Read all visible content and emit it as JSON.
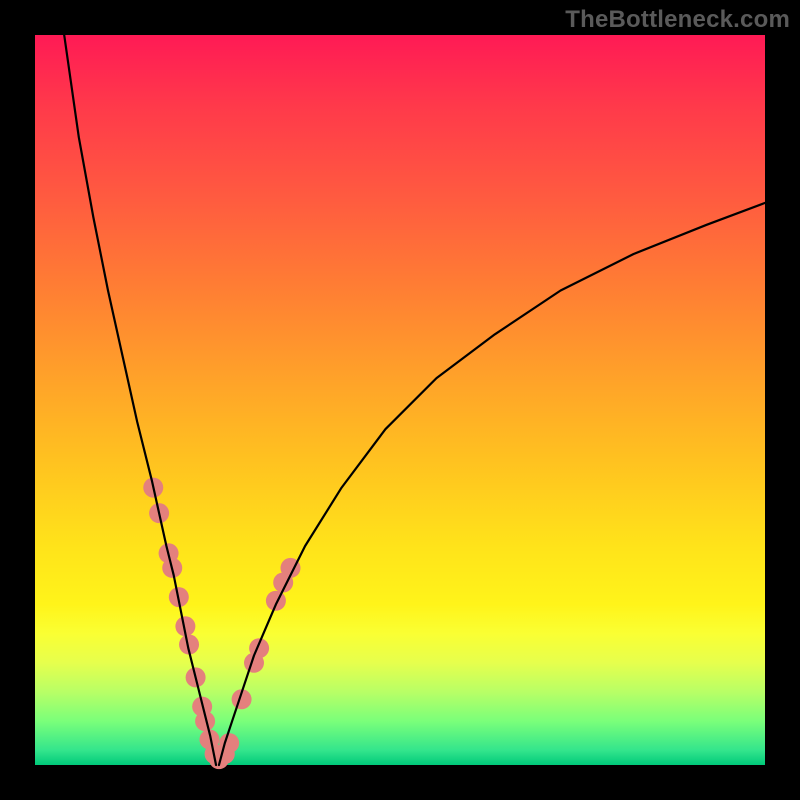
{
  "watermark": "TheBottleneck.com",
  "chart_data": {
    "type": "line",
    "title": "",
    "xlabel": "",
    "ylabel": "",
    "xlim": [
      0,
      100
    ],
    "ylim": [
      0,
      100
    ],
    "grid": false,
    "legend": false,
    "series": [
      {
        "name": "left-branch",
        "color": "#000000",
        "x": [
          4,
          6,
          8,
          10,
          12,
          14,
          16,
          18,
          19,
          20,
          21,
          22,
          23,
          24,
          24.8
        ],
        "y": [
          100,
          86,
          75,
          65,
          56,
          47,
          39,
          30,
          26,
          21,
          16,
          12,
          8,
          4,
          0
        ]
      },
      {
        "name": "right-branch",
        "color": "#000000",
        "x": [
          25.2,
          26,
          27,
          28,
          30,
          33,
          37,
          42,
          48,
          55,
          63,
          72,
          82,
          92,
          100
        ],
        "y": [
          0,
          3,
          6,
          9,
          15,
          22,
          30,
          38,
          46,
          53,
          59,
          65,
          70,
          74,
          77
        ]
      }
    ],
    "markers": [
      {
        "x": 16.2,
        "y": 38.0
      },
      {
        "x": 17.0,
        "y": 34.5
      },
      {
        "x": 18.3,
        "y": 29.0
      },
      {
        "x": 18.8,
        "y": 27.0
      },
      {
        "x": 19.7,
        "y": 23.0
      },
      {
        "x": 20.6,
        "y": 19.0
      },
      {
        "x": 21.1,
        "y": 16.5
      },
      {
        "x": 22.0,
        "y": 12.0
      },
      {
        "x": 22.9,
        "y": 8.0
      },
      {
        "x": 23.3,
        "y": 6.0
      },
      {
        "x": 23.9,
        "y": 3.5
      },
      {
        "x": 24.6,
        "y": 1.5
      },
      {
        "x": 25.2,
        "y": 0.8
      },
      {
        "x": 26.0,
        "y": 1.5
      },
      {
        "x": 26.6,
        "y": 3.0
      },
      {
        "x": 28.3,
        "y": 9.0
      },
      {
        "x": 30.0,
        "y": 14.0
      },
      {
        "x": 30.7,
        "y": 16.0
      },
      {
        "x": 33.0,
        "y": 22.5
      },
      {
        "x": 34.0,
        "y": 25.0
      },
      {
        "x": 35.0,
        "y": 27.0
      }
    ],
    "marker_style": {
      "color": "#e4807d",
      "radius_px": 10
    }
  }
}
